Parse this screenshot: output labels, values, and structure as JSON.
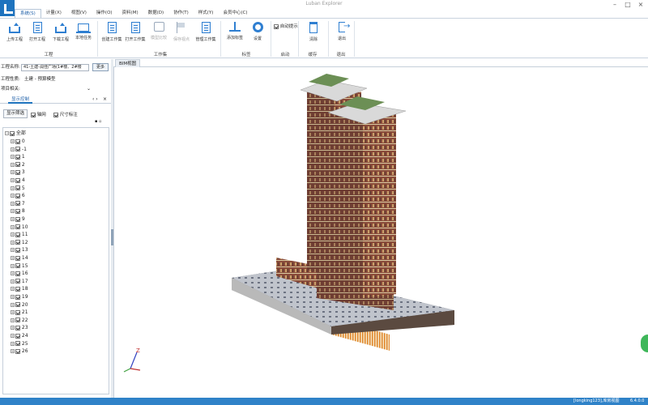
{
  "window": {
    "title": "Luban Explorer"
  },
  "menu": [
    {
      "label": "系统(S)",
      "active": true
    },
    {
      "label": "计量(X)"
    },
    {
      "label": "视图(V)"
    },
    {
      "label": "操作(O)"
    },
    {
      "label": "资料(M)"
    },
    {
      "label": "数据(D)"
    },
    {
      "label": "协作(T)"
    },
    {
      "label": "样式(Y)"
    },
    {
      "label": "会员中心(C)"
    }
  ],
  "ribbon": {
    "buttons": [
      {
        "name": "upload-project",
        "label": "上传工程",
        "icon": "upload-icon"
      },
      {
        "name": "open-project",
        "label": "打开工程",
        "icon": "document-icon"
      },
      {
        "name": "download-project",
        "label": "下载工程",
        "icon": "download-icon"
      },
      {
        "name": "local-tasks",
        "label": "本地任务",
        "icon": "laptop-icon"
      },
      {
        "name": "create-workset",
        "label": "创建工作集",
        "icon": "create-workset-icon"
      },
      {
        "name": "open-workset",
        "label": "打开工作集",
        "icon": "open-workset-icon"
      },
      {
        "name": "model-compare",
        "label": "模型比较",
        "icon": "layers-icon",
        "disabled": true
      },
      {
        "name": "flag-save",
        "label": "保存视点",
        "icon": "flag-icon",
        "disabled": true
      },
      {
        "name": "manage-workset",
        "label": "管理工作集",
        "icon": "manage-workset-icon"
      },
      {
        "name": "add-tag",
        "label": "添加标签",
        "icon": "tag-icon"
      },
      {
        "name": "settings",
        "label": "设置",
        "icon": "gear-icon"
      },
      {
        "name": "clear",
        "label": "清除",
        "icon": "trash-icon"
      },
      {
        "name": "exit",
        "label": "退出",
        "icon": "exit-icon"
      }
    ],
    "auto_prompt": {
      "label": "自动提示",
      "checked": true
    },
    "groups": [
      "工程",
      "工作集",
      "标签",
      "启动",
      "缓存",
      "退出"
    ]
  },
  "project": {
    "name_label": "工程名称:",
    "name_value": "41-土建-润佳广场(1#楼、2#楼",
    "more_label": "更多",
    "type_label": "工程性质:",
    "type_value": "土建 - 预算模型",
    "related_label": "项目相关:"
  },
  "panel": {
    "tab_label": "显示控制",
    "filter_label": "显示筛选",
    "axis_label": "轴网",
    "dim_label": "尺寸标注",
    "tree_root": "全部",
    "floors": [
      "0",
      "-1",
      "1",
      "2",
      "3",
      "4",
      "5",
      "6",
      "7",
      "8",
      "9",
      "10",
      "11",
      "12",
      "13",
      "14",
      "15",
      "16",
      "17",
      "18",
      "19",
      "20",
      "21",
      "22",
      "23",
      "24",
      "25",
      "26"
    ]
  },
  "view": {
    "tab_label": "BIM视图",
    "axis_z": "Z"
  },
  "status": {
    "user": "[longking123],库房视图",
    "version": "6.4.0.0"
  },
  "colors": {
    "accent": "#1e73be",
    "status_bar": "#2f82c8",
    "facade": "#8a4b3a",
    "roof": "#d9d9d9"
  }
}
